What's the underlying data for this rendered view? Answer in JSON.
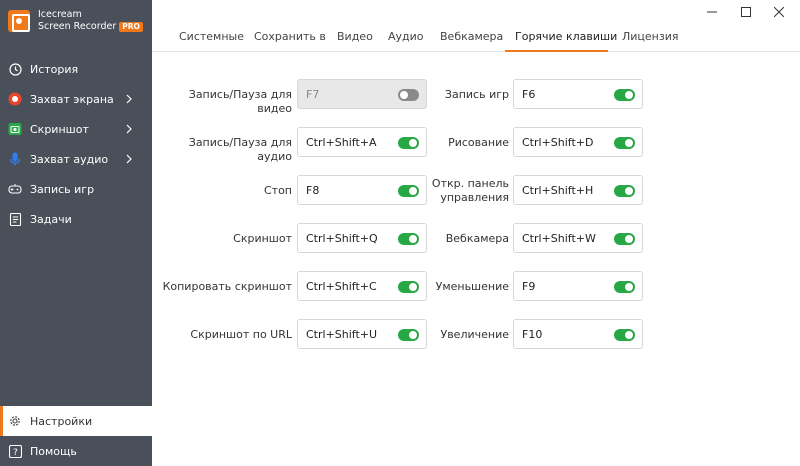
{
  "app": {
    "name_line1": "Icecream",
    "name_line2": "Screen Recorder",
    "badge": "PRO"
  },
  "sidebar": {
    "items": [
      {
        "label": "История",
        "icon": "clock-icon"
      },
      {
        "label": "Захват экрана",
        "icon": "record-icon"
      },
      {
        "label": "Скриншот",
        "icon": "camera-icon"
      },
      {
        "label": "Захват аудио",
        "icon": "microphone-icon"
      },
      {
        "label": "Запись игр",
        "icon": "gamepad-icon"
      },
      {
        "label": "Задачи",
        "icon": "tasks-icon"
      }
    ],
    "settings_label": "Настройки",
    "help_label": "Помощь"
  },
  "tabs": [
    {
      "label": "Системные"
    },
    {
      "label": "Сохранить в"
    },
    {
      "label": "Видео"
    },
    {
      "label": "Аудио"
    },
    {
      "label": "Вебкамера"
    },
    {
      "label": "Горячие клавиши"
    },
    {
      "label": "Лицензия"
    }
  ],
  "active_tab": "Горячие клавиши",
  "hotkeys_left": [
    {
      "label": "Запись/Пауза для видео",
      "value": "F7",
      "enabled": false
    },
    {
      "label": "Запись/Пауза для аудио",
      "value": "Ctrl+Shift+A",
      "enabled": true
    },
    {
      "label": "Стоп",
      "value": "F8",
      "enabled": true
    },
    {
      "label": "Скриншот",
      "value": "Ctrl+Shift+Q",
      "enabled": true
    },
    {
      "label": "Копировать скриншот",
      "value": "Ctrl+Shift+C",
      "enabled": true
    },
    {
      "label": "Скриншот по URL",
      "value": "Ctrl+Shift+U",
      "enabled": true
    }
  ],
  "hotkeys_right": [
    {
      "label": "Запись игр",
      "value": "F6",
      "enabled": true
    },
    {
      "label": "Рисование",
      "value": "Ctrl+Shift+D",
      "enabled": true
    },
    {
      "label_line1": "Откр. панель",
      "label_line2": "управления",
      "value": "Ctrl+Shift+H",
      "enabled": true
    },
    {
      "label": "Вебкамера",
      "value": "Ctrl+Shift+W",
      "enabled": true
    },
    {
      "label": "Уменьшение",
      "value": "F9",
      "enabled": true
    },
    {
      "label": "Увеличение",
      "value": "F10",
      "enabled": true
    }
  ],
  "colors": {
    "accent": "#f07a1b",
    "sidebar_bg": "#4a5059",
    "toggle_on": "#27a844",
    "toggle_off": "#8a8a8a"
  }
}
